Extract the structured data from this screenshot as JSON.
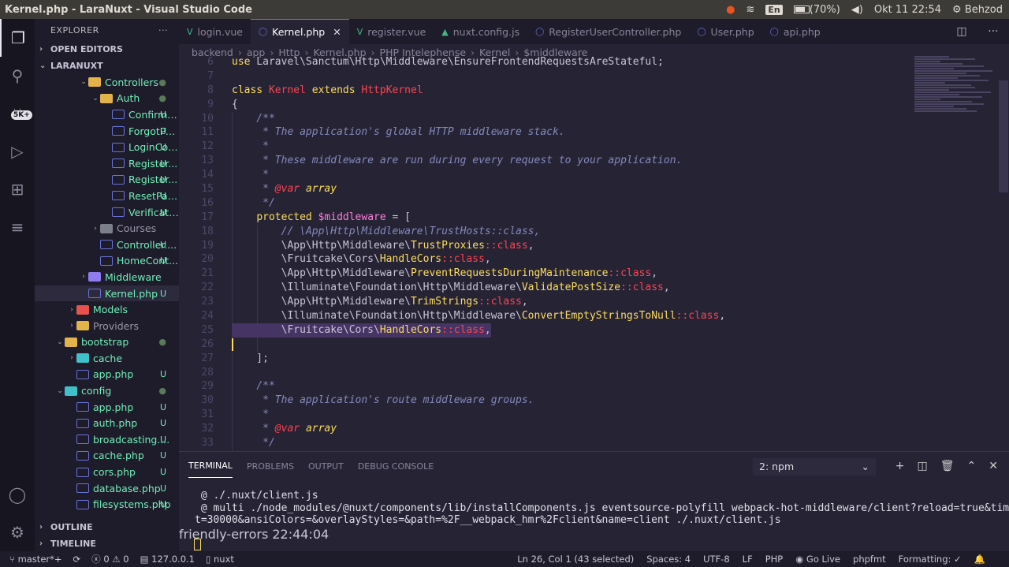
{
  "titlebar": {
    "title": "Kernel.php - LaraNuxt - Visual Studio Code",
    "language": "En",
    "battery": "(70%)",
    "datetime": "Okt 11 22:54",
    "user": "Behzod"
  },
  "activity": {
    "badge": "5K+"
  },
  "sidebar": {
    "header": "EXPLORER",
    "more": "···",
    "open_editors": "OPEN EDITORS",
    "project": "LARANUXT",
    "items": [
      {
        "label": "Controllers",
        "mark": "●",
        "depth": 2,
        "kind": "folder-open"
      },
      {
        "label": "Auth",
        "mark": "●",
        "depth": 3,
        "kind": "folder-open"
      },
      {
        "label": "ConfirmP...",
        "mark": "U",
        "depth": 4,
        "kind": "php"
      },
      {
        "label": "ForgotPa...",
        "mark": "U",
        "depth": 4,
        "kind": "php"
      },
      {
        "label": "LoginCon...",
        "mark": "U",
        "depth": 4,
        "kind": "php"
      },
      {
        "label": "Register...",
        "mark": "U",
        "depth": 4,
        "kind": "php"
      },
      {
        "label": "Register...",
        "mark": "U",
        "depth": 4,
        "kind": "php"
      },
      {
        "label": "ResetPas...",
        "mark": "U",
        "depth": 4,
        "kind": "php"
      },
      {
        "label": "Verificati...",
        "mark": "U",
        "depth": 4,
        "kind": "php"
      },
      {
        "label": "Courses",
        "mark": "",
        "depth": 3,
        "kind": "folder-grey"
      },
      {
        "label": "Controller....",
        "mark": "U",
        "depth": 3,
        "kind": "php"
      },
      {
        "label": "HomeCont...",
        "mark": "U",
        "depth": 3,
        "kind": "php"
      },
      {
        "label": "Middleware",
        "mark": "",
        "depth": 2,
        "kind": "folder-purple"
      },
      {
        "label": "Kernel.php",
        "mark": "U",
        "depth": 2,
        "kind": "php-selected"
      },
      {
        "label": "Models",
        "mark": "",
        "depth": 1,
        "kind": "folder-red"
      },
      {
        "label": "Providers",
        "mark": "",
        "depth": 1,
        "kind": "folder"
      },
      {
        "label": "bootstrap",
        "mark": "●",
        "depth": 0,
        "kind": "folder-open"
      },
      {
        "label": "cache",
        "mark": "",
        "depth": 1,
        "kind": "folder-teal"
      },
      {
        "label": "app.php",
        "mark": "U",
        "depth": 1,
        "kind": "php"
      },
      {
        "label": "config",
        "mark": "●",
        "depth": 0,
        "kind": "folder-teal-open"
      },
      {
        "label": "app.php",
        "mark": "U",
        "depth": 1,
        "kind": "php"
      },
      {
        "label": "auth.php",
        "mark": "U",
        "depth": 1,
        "kind": "php"
      },
      {
        "label": "broadcasting....",
        "mark": "U",
        "depth": 1,
        "kind": "php"
      },
      {
        "label": "cache.php",
        "mark": "U",
        "depth": 1,
        "kind": "php"
      },
      {
        "label": "cors.php",
        "mark": "U",
        "depth": 1,
        "kind": "php"
      },
      {
        "label": "database.php",
        "mark": "U",
        "depth": 1,
        "kind": "php"
      },
      {
        "label": "filesystems.php",
        "mark": "U",
        "depth": 1,
        "kind": "php"
      }
    ],
    "outline": "OUTLINE",
    "timeline": "TIMELINE"
  },
  "tabs": [
    {
      "label": "login.vue",
      "icon": "vue",
      "active": false
    },
    {
      "label": "Kernel.php",
      "icon": "php",
      "active": true
    },
    {
      "label": "register.vue",
      "icon": "vue",
      "active": false
    },
    {
      "label": "nuxt.config.js",
      "icon": "nuxt",
      "active": false
    },
    {
      "label": "RegisterUserController.php",
      "icon": "php",
      "active": false
    },
    {
      "label": "User.php",
      "icon": "php",
      "active": false
    },
    {
      "label": "api.php",
      "icon": "php",
      "active": false
    }
  ],
  "breadcrumb": [
    "backend",
    "app",
    "Http",
    "Kernel.php",
    "PHP Intelephense",
    "Kernel",
    "$middleware"
  ],
  "code": [
    {
      "n": "6",
      "t": "use Laravel\\Sanctum\\Http\\Middleware\\EnsureFrontendRequestsAreStateful;"
    },
    {
      "n": "7",
      "t": ""
    },
    {
      "n": "8",
      "t": "class Kernel extends HttpKernel"
    },
    {
      "n": "9",
      "t": "{"
    },
    {
      "n": "10",
      "t": "    /**"
    },
    {
      "n": "11",
      "t": "     * The application's global HTTP middleware stack."
    },
    {
      "n": "12",
      "t": "     *"
    },
    {
      "n": "13",
      "t": "     * These middleware are run during every request to your application."
    },
    {
      "n": "14",
      "t": "     *"
    },
    {
      "n": "15",
      "t": "     * @var array"
    },
    {
      "n": "16",
      "t": "     */"
    },
    {
      "n": "17",
      "t": "    protected $middleware = ["
    },
    {
      "n": "18",
      "t": "        // \\App\\Http\\Middleware\\TrustHosts::class,"
    },
    {
      "n": "19",
      "t": "        \\App\\Http\\Middleware\\TrustProxies::class,"
    },
    {
      "n": "20",
      "t": "        \\Fruitcake\\Cors\\HandleCors::class,"
    },
    {
      "n": "21",
      "t": "        \\App\\Http\\Middleware\\PreventRequestsDuringMaintenance::class,"
    },
    {
      "n": "22",
      "t": "        \\Illuminate\\Foundation\\Http\\Middleware\\ValidatePostSize::class,"
    },
    {
      "n": "23",
      "t": "        \\App\\Http\\Middleware\\TrimStrings::class,"
    },
    {
      "n": "24",
      "t": "        \\Illuminate\\Foundation\\Http\\Middleware\\ConvertEmptyStringsToNull::class,"
    },
    {
      "n": "25",
      "t": "        \\Fruitcake\\Cors\\HandleCors::class,"
    },
    {
      "n": "26",
      "t": ""
    },
    {
      "n": "27",
      "t": "    ];"
    },
    {
      "n": "28",
      "t": ""
    },
    {
      "n": "29",
      "t": "    /**"
    },
    {
      "n": "30",
      "t": "     * The application's route middleware groups."
    },
    {
      "n": "31",
      "t": "     *"
    },
    {
      "n": "32",
      "t": "     * @var array"
    },
    {
      "n": "33",
      "t": "     */"
    }
  ],
  "panel": {
    "tabs": [
      "TERMINAL",
      "PROBLEMS",
      "OUTPUT",
      "DEBUG CONSOLE"
    ],
    "terminal_select": "2: npm",
    "lines": [
      " @ ./.nuxt/client.js",
      " @ multi ./node_modules/@nuxt/components/lib/installComponents.js eventsource-polyfill webpack-hot-middleware/client?reload=true&timeou",
      "t=30000&ansiColors=&overlayStyles=&path=%2F__webpack_hmr%2Fclient&name=client ./.nuxt/client.js"
    ],
    "timestamp": "friendly-errors 22:44:04"
  },
  "statusbar": {
    "branch": "master*+",
    "errors": "0",
    "warnings": "0",
    "host": "127.0.0.1",
    "process": "nuxt",
    "position": "Ln 26, Col 1 (43 selected)",
    "spaces": "Spaces: 4",
    "encoding": "UTF-8",
    "eol": "LF",
    "language": "PHP",
    "golive": "Go Live",
    "formatter": "phpfmt",
    "formatting": "Formatting: "
  }
}
